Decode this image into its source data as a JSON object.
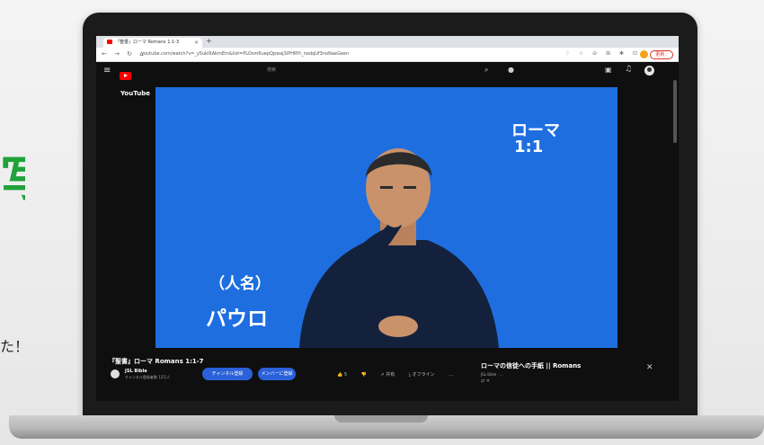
{
  "side": {
    "green_text": "写",
    "caption": "た！"
  },
  "browser": {
    "tab_title": "『聖書』ローマ Romans 1:1-3",
    "tab_close": "×",
    "new_tab": "+",
    "nav_icons": "← → ↻ ⌂",
    "url": "youtube.com/watch?v=_y5ukI6AkmEm&list=PLOsm6uepQpwaj3iPHRYt_nedqUf3noNaeGeen",
    "browser_icons": "♢ ☆ ⊖ ⊞ ✱ ⊡",
    "update_label": "更新 :"
  },
  "youtube": {
    "menu_icon": "≡",
    "logo_word": "YouTube",
    "search_placeholder": "検索",
    "search_icon": "⌕",
    "mic_icon": "●",
    "create_icon": "▣",
    "bell_icon": "♫"
  },
  "video": {
    "caption_top_1": "ローマ",
    "caption_top_2": "1:1",
    "caption_bottom_1": "（人名）",
    "caption_bottom_2": "パウロ",
    "title": "『聖書』ローマ Romans 1:1-7",
    "channel_name": "JSL Bible",
    "channel_sub": "チャンネル登録者数 12万人",
    "subscribe_label": "チャンネル登録",
    "join_label": "メンバーに登録",
    "actions": [
      "👍 5",
      "👎",
      "⇗ 共有",
      "⤓ オフライン",
      "…"
    ]
  },
  "related": {
    "title": "ローマの信徒への手紙 || Romans",
    "channel": "JSL Bible · ...",
    "meta": "⇄ ✕",
    "close_icon": "✕"
  },
  "colors": {
    "video_bg": "#1e6ee0",
    "accent_blue": "#2a61d8",
    "yt_red": "#ff0000",
    "side_green": "#1fa33a"
  }
}
